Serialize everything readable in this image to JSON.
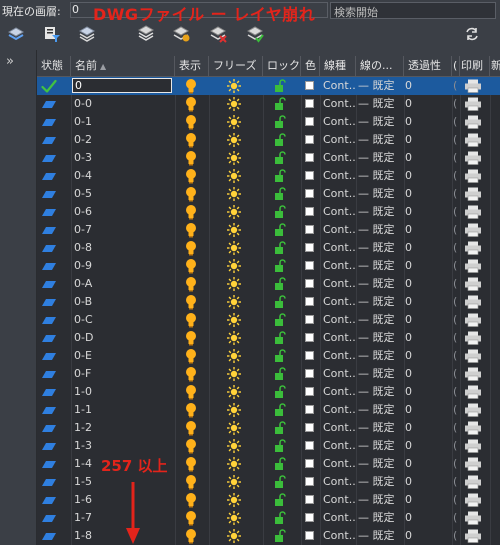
{
  "topbar": {
    "current_layer_label": "現在の画層:",
    "current_layer_value": "0",
    "search_placeholder": "検索開始"
  },
  "annotations": {
    "title": "DWGファイル ー レイヤ崩れ",
    "count_note": "257 以上"
  },
  "toolbar": {
    "icons": [
      "new-layer-icon",
      "filter-icon",
      "layer-state-icon",
      "layer-stack-icon",
      "new-layer-vp-icon",
      "delete-layer-icon",
      "set-current-icon",
      "refresh-icon"
    ]
  },
  "left_strip": {
    "expand_glyph": "»"
  },
  "table": {
    "headers": {
      "status": "状態",
      "name": "名前",
      "sort_glyph": "▲",
      "show": "表示",
      "freeze": "フリーズ",
      "lock": "ロック",
      "color": "色",
      "linetype": "線種",
      "lineweight": "線の...",
      "transparency": "透過性",
      "plotstyle_glyph": "(",
      "plot": "印刷",
      "new": "新"
    },
    "linetype_value": "Cont...",
    "lineweight_value": "— 既定",
    "transparency_value": "0",
    "plotstyle_value": "(",
    "rows": [
      {
        "name": "0",
        "selected": true
      },
      {
        "name": "0-0"
      },
      {
        "name": "0-1"
      },
      {
        "name": "0-2"
      },
      {
        "name": "0-3"
      },
      {
        "name": "0-4"
      },
      {
        "name": "0-5"
      },
      {
        "name": "0-6"
      },
      {
        "name": "0-7"
      },
      {
        "name": "0-8"
      },
      {
        "name": "0-9"
      },
      {
        "name": "0-A"
      },
      {
        "name": "0-B"
      },
      {
        "name": "0-C"
      },
      {
        "name": "0-D"
      },
      {
        "name": "0-E"
      },
      {
        "name": "0-F"
      },
      {
        "name": "1-0"
      },
      {
        "name": "1-1"
      },
      {
        "name": "1-2"
      },
      {
        "name": "1-3"
      },
      {
        "name": "1-4"
      },
      {
        "name": "1-5"
      },
      {
        "name": "1-6"
      },
      {
        "name": "1-7"
      },
      {
        "name": "1-8"
      }
    ]
  },
  "colors": {
    "bulb": "#ffb11a",
    "sun": "#ffd23a",
    "lock": "#3bbd3b",
    "layer_icon": "#2f7fe0",
    "check": "#42c242",
    "annotation": "#e3241b"
  }
}
